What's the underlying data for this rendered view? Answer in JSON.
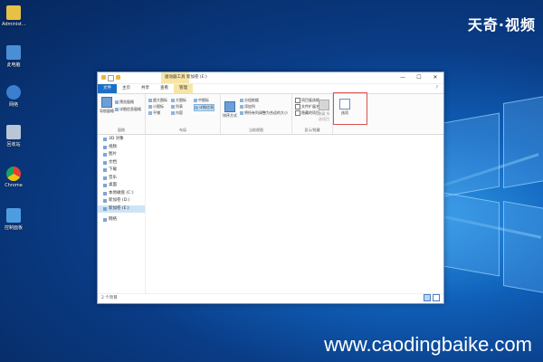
{
  "desktop": {
    "icons": [
      {
        "label": "Administ...",
        "color": "#e7c046"
      },
      {
        "label": "此电脑",
        "color": "#4a8fd6"
      },
      {
        "label": "网络",
        "color": "#3b7fd0"
      },
      {
        "label": "回收站",
        "color": "#b8c6d6"
      },
      {
        "label": "Chrome",
        "color": "#e34133"
      },
      {
        "label": "控制面板",
        "color": "#4d9ee0"
      }
    ]
  },
  "watermark": {
    "top": "天奇·视频",
    "bottom": "www.caodingbaike.com"
  },
  "window": {
    "context_tab": "驱动器工具",
    "title": "新加卷 (E:)",
    "controls": {
      "minimize": "—",
      "maximize": "☐",
      "close": "✕"
    },
    "tabs": [
      "文件",
      "主页",
      "共享",
      "查看",
      "管理"
    ],
    "ribbon": {
      "pane": {
        "big": "导航窗格",
        "preview": "预览窗格",
        "details": "详细信息窗格",
        "label": "窗格"
      },
      "layout": {
        "items": [
          "超大图标",
          "大图标",
          "中图标",
          "小图标",
          "列表",
          "详细信息",
          "平铺",
          "内容"
        ],
        "label": "布局"
      },
      "current_view": {
        "sort": "排序方式",
        "group": "分组依据",
        "add_column": "添加列",
        "fit": "将所有列调整为合适的大小",
        "label": "当前视图"
      },
      "show_hide": {
        "checkbox": "项目复选框",
        "ext": "文件扩展名",
        "hidden": "隐藏的项目",
        "hide_selected": "隐藏",
        "hide_selected2": "所选项目",
        "label": "显示/隐藏"
      },
      "options": {
        "label": "选项"
      }
    },
    "nav": [
      {
        "label": "3D 对象",
        "selected": false
      },
      {
        "label": "视频",
        "selected": false
      },
      {
        "label": "图片",
        "selected": false
      },
      {
        "label": "文档",
        "selected": false
      },
      {
        "label": "下载",
        "selected": false
      },
      {
        "label": "音乐",
        "selected": false
      },
      {
        "label": "桌面",
        "selected": false
      },
      {
        "label": "本地磁盘 (C:)",
        "selected": false
      },
      {
        "label": "新加卷 (D:)",
        "selected": false
      },
      {
        "label": "新加卷 (E:)",
        "selected": true
      },
      {
        "label": "网络",
        "selected": false
      }
    ],
    "status": "2 个项目"
  }
}
